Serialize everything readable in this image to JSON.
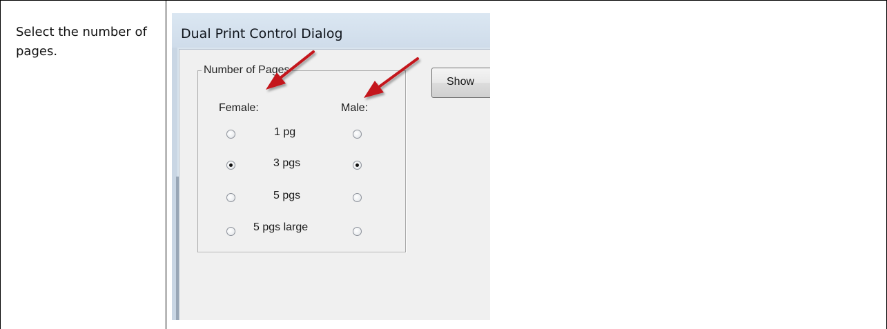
{
  "instruction": "Select the number of pages.",
  "dialog": {
    "title": "Dual Print Control Dialog",
    "group_label": "Number of Pages",
    "col_female": "Female:",
    "col_male": "Male:",
    "options": [
      {
        "label": "1 pg",
        "female_checked": false,
        "male_checked": false
      },
      {
        "label": "3 pgs",
        "female_checked": true,
        "male_checked": true
      },
      {
        "label": "5 pgs",
        "female_checked": false,
        "male_checked": false
      },
      {
        "label": "5 pgs large",
        "female_checked": false,
        "male_checked": false
      }
    ],
    "show_button": "Show"
  },
  "colors": {
    "arrow": "#c4161c",
    "group_border": "#a9a9a9"
  }
}
